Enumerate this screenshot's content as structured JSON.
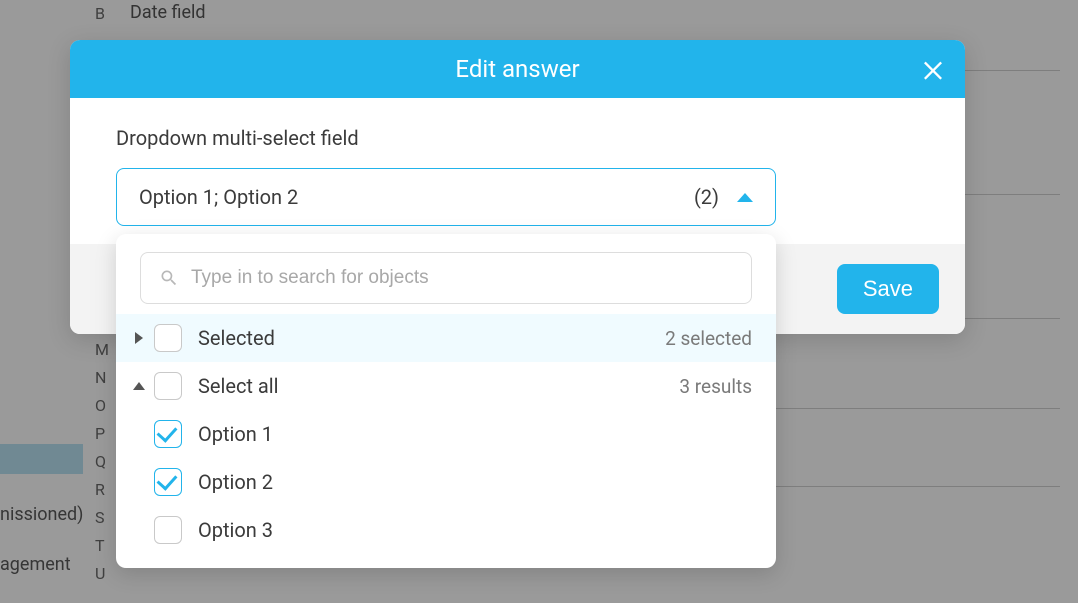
{
  "background": {
    "date_field_label": "Date field",
    "letters": [
      "B",
      "",
      "",
      "",
      "",
      "",
      "",
      "",
      "",
      "",
      "",
      "",
      "M",
      "N",
      "O",
      "P",
      "Q",
      "R",
      "S",
      "T",
      "U"
    ],
    "pill1": "nissioned)",
    "pill2": "agement"
  },
  "modal": {
    "title": "Edit answer",
    "field_label": "Dropdown multi-select field",
    "select": {
      "value": "Option 1; Option 2",
      "count": "(2)"
    },
    "save_label": "Save"
  },
  "dropdown": {
    "search_placeholder": "Type in to search for objects",
    "selected_group": {
      "label": "Selected",
      "meta": "2 selected"
    },
    "all_group": {
      "label": "Select all",
      "meta": "3 results"
    },
    "options": [
      {
        "label": "Option 1",
        "checked": true
      },
      {
        "label": "Option 2",
        "checked": true
      },
      {
        "label": "Option 3",
        "checked": false
      }
    ]
  }
}
